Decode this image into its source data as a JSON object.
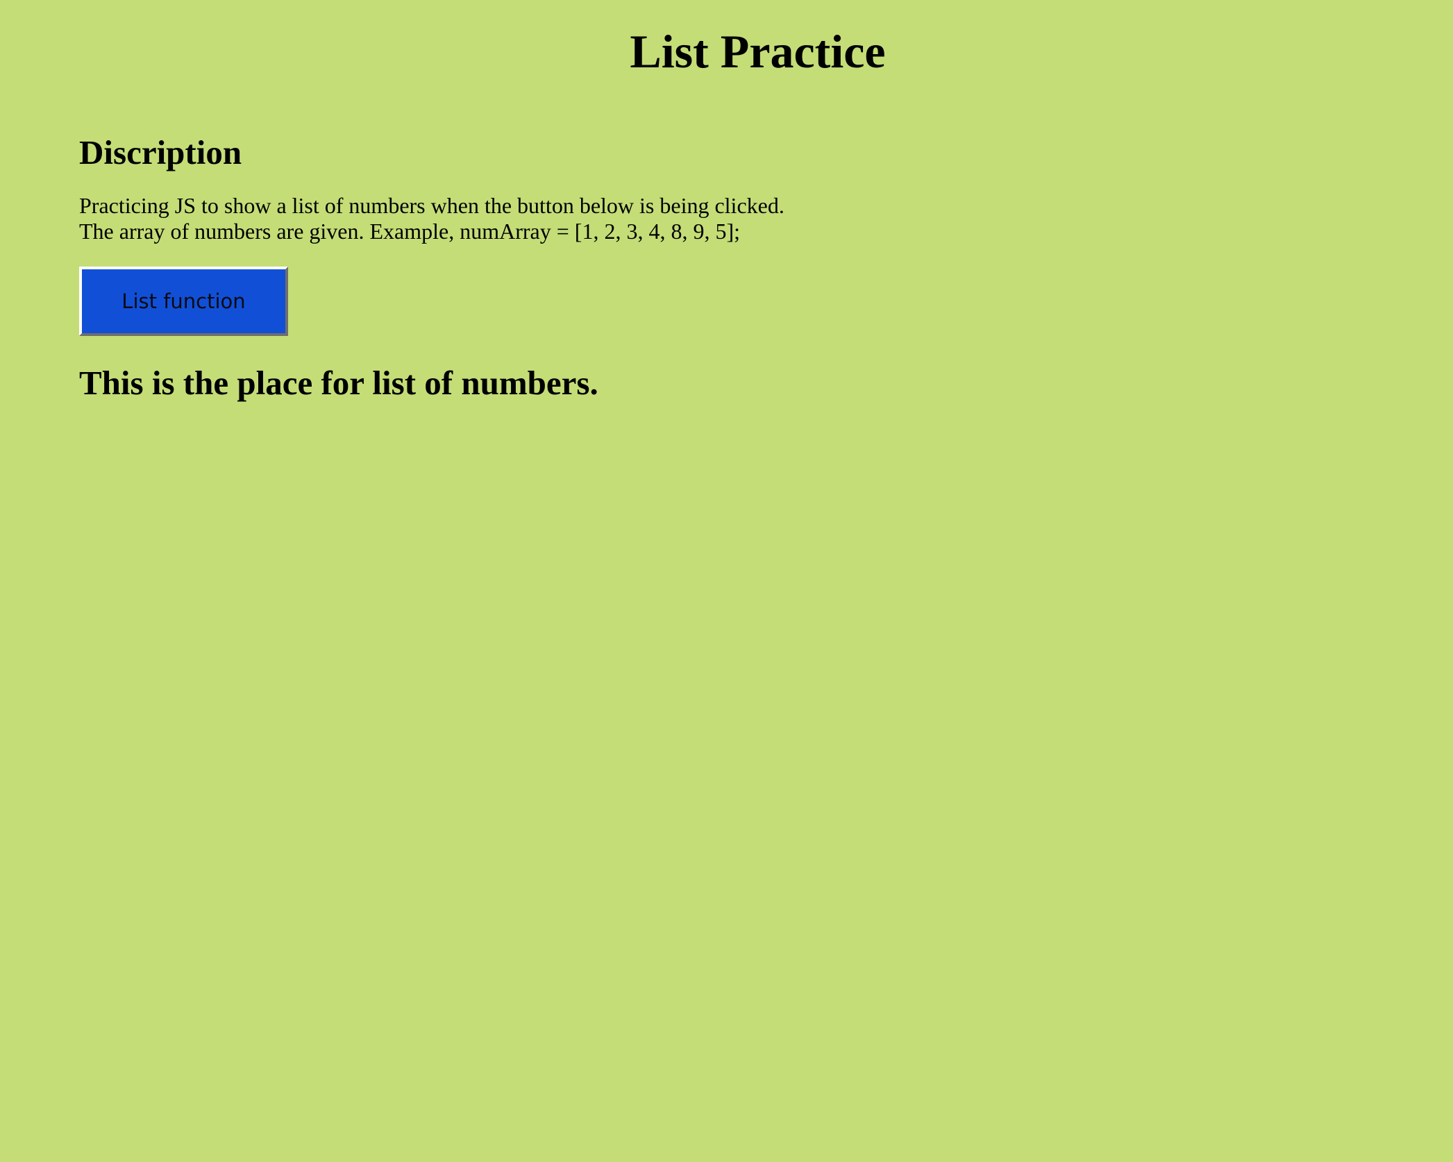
{
  "page": {
    "title": "List Practice",
    "background_color": "#c4dd77"
  },
  "description": {
    "heading": "Discription",
    "line1": "Practicing JS to show a list of numbers when the button below is being clicked.",
    "line2": "The array of numbers are given. Example, numArray = [1, 2, 3, 4, 8, 9, 5];"
  },
  "button": {
    "label": "List function",
    "color": "#1150d6"
  },
  "output": {
    "text": "This is the place for list of numbers."
  }
}
